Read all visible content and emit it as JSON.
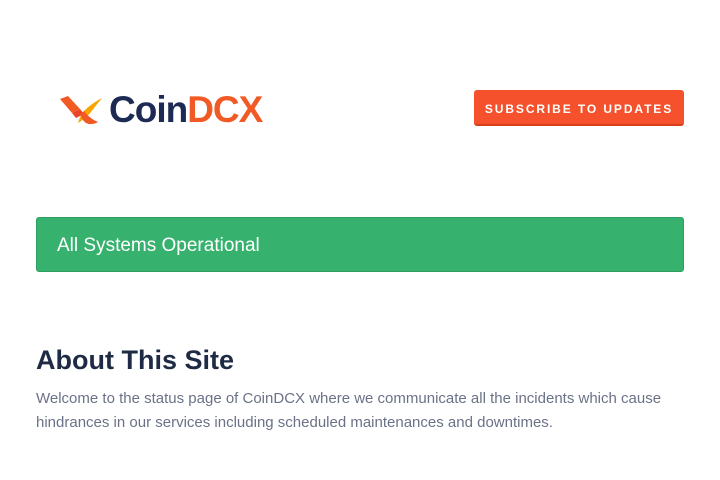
{
  "brand": {
    "name_part1": "Coin",
    "name_part2": "DCX",
    "logo_icon": "coindcx-logo-icon",
    "colors": {
      "primary": "#1d2b54",
      "accent": "#f15a24",
      "mark_yellow": "#f7a600"
    }
  },
  "header": {
    "subscribe_label": "SUBSCRIBE TO UPDATES",
    "subscribe_color": "#f4512c"
  },
  "status": {
    "text": "All Systems Operational",
    "color": "#36b26e"
  },
  "about": {
    "title": "About This Site",
    "description": "Welcome to the status page of CoinDCX where we communicate all the incidents which cause hindrances in our services including scheduled maintenances and downtimes."
  }
}
